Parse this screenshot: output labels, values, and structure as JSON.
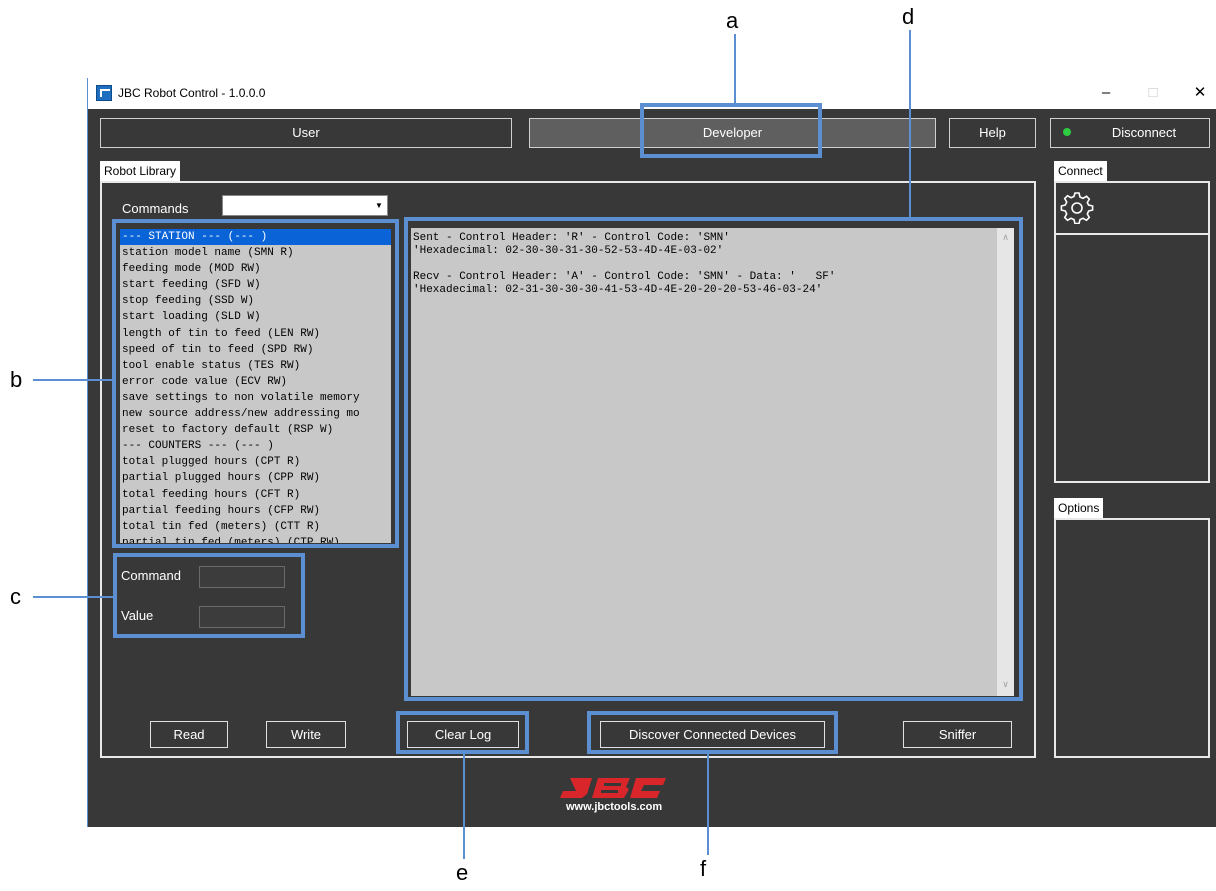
{
  "window": {
    "title": "JBC Robot Control - 1.0.0.0",
    "minimize": "–",
    "maximize": "□",
    "close": "✕"
  },
  "topbar": {
    "user": "User",
    "developer": "Developer",
    "help": "Help",
    "disconnect": "Disconnect",
    "status_color": "#2ecc40"
  },
  "robot_library": {
    "tab": "Robot Library",
    "commands_label": "Commands",
    "commands_value": "",
    "items": [
      "--- STATION --- (--- )",
      "station model name (SMN R)",
      "feeding mode (MOD RW)",
      "start feeding (SFD W)",
      "stop feeding (SSD W)",
      "start loading (SLD W)",
      "length of tin to feed (LEN RW)",
      "speed of tin to feed (SPD RW)",
      "tool enable status (TES RW)",
      "error code value (ECV RW)",
      "save settings to non volatile memory",
      "new source address/new addressing mo",
      "reset to factory default (RSP W)",
      "--- COUNTERS --- (--- )",
      "total plugged hours (CPT R)",
      "partial plugged hours (CPP RW)",
      "total feeding hours (CFT R)",
      "partial feeding hours (CFP RW)",
      "total tin fed (meters) (CTT R)",
      "partial tin fed (meters) (CTP RW)"
    ],
    "selected_index": 0,
    "command_label": "Command",
    "value_label": "Value",
    "command_value": "",
    "value_value": "",
    "log": [
      "Sent - Control Header: 'R' - Control Code: 'SMN'",
      "'Hexadecimal: 02-30-30-31-30-52-53-4D-4E-03-02'",
      "",
      "Recv - Control Header: 'A' - Control Code: 'SMN' - Data: '   SF'",
      "'Hexadecimal: 02-31-30-30-30-41-53-4D-4E-20-20-20-53-46-03-24'"
    ],
    "buttons": {
      "read": "Read",
      "write": "Write",
      "clear_log": "Clear Log",
      "discover": "Discover Connected Devices",
      "sniffer": "Sniffer"
    }
  },
  "right_panel": {
    "connect_tab": "Connect",
    "options_tab": "Options"
  },
  "footer": {
    "logo": "JBC",
    "url": "www.jbctools.com"
  },
  "callouts": [
    "a",
    "b",
    "c",
    "d",
    "e",
    "f"
  ],
  "colors": {
    "highlight": "#5b8fd1",
    "selection": "#0a64d8",
    "logo_red": "#d9262b"
  }
}
